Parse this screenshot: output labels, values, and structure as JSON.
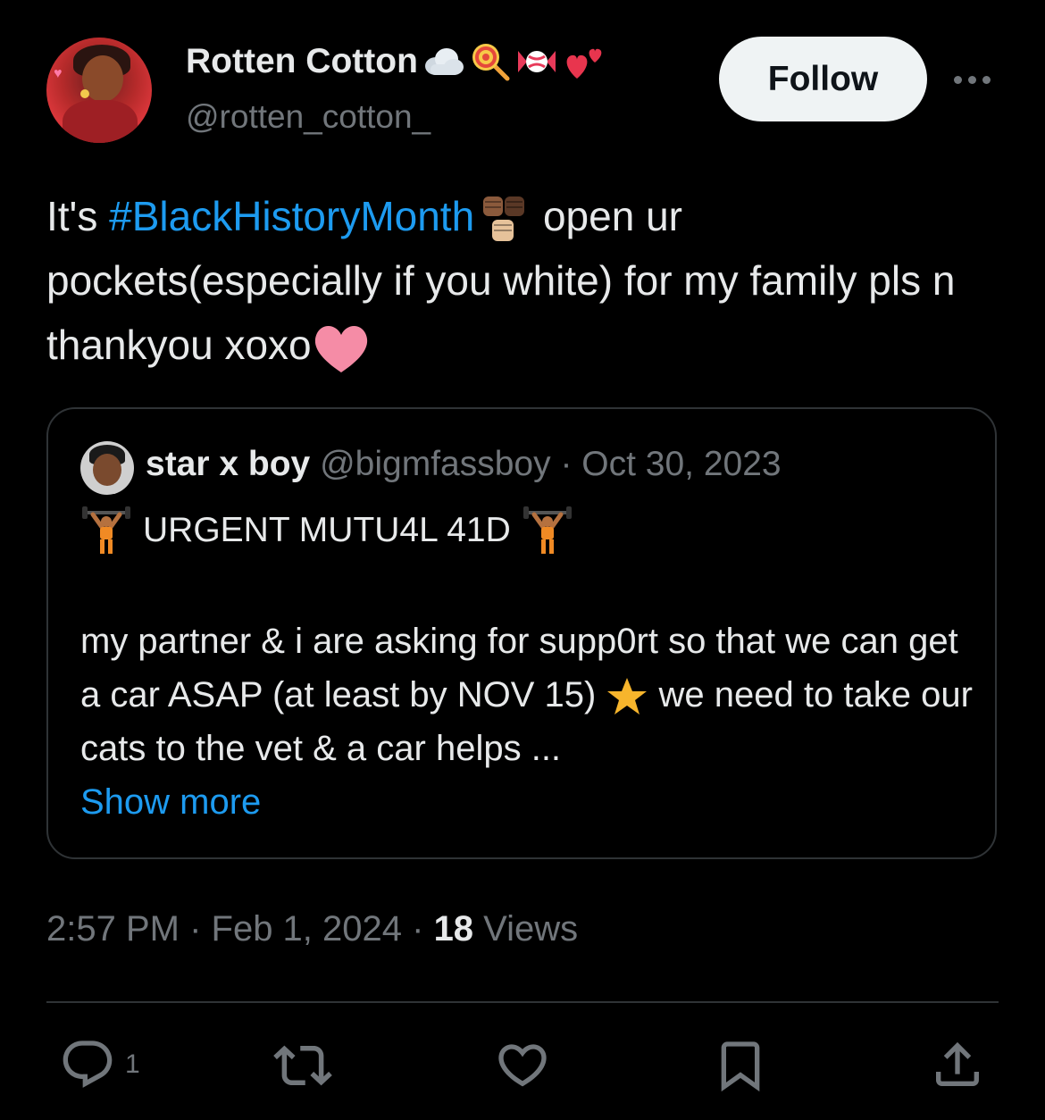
{
  "author": {
    "name": "Rotten Cotton",
    "name_emojis": [
      "cloud-icon",
      "lollipop-icon",
      "candy-icon",
      "two-hearts-icon"
    ],
    "handle": "@rotten_cotton_"
  },
  "follow_label": "Follow",
  "tweet": {
    "text_before": "It's ",
    "hashtag": "#BlackHistoryMonth",
    "text_after_emoji": " open ur pockets(especially if you white) for my family pls n thankyou xoxo"
  },
  "quote": {
    "name": "star x boy",
    "handle": "@bigmfassboy",
    "separator": " · ",
    "date": "Oct 30, 2023",
    "line1": "URGENT MUTU4L 41D",
    "body_part1": "my partner & i are asking for supp0rt so that we can get a car ASAP (at least by NOV 15) ",
    "body_part2": " we need to take our cats to the vet & a car helps ...",
    "show_more": "Show more"
  },
  "meta": {
    "time": "2:57 PM",
    "sep1": " · ",
    "date": "Feb 1, 2024",
    "sep2": " · ",
    "views_count": "18",
    "views_label": " Views"
  },
  "actions": {
    "reply_count": "1"
  },
  "colors": {
    "background": "#000000",
    "text": "#e7e9ea",
    "muted": "#71767b",
    "link": "#1d9bf0",
    "border": "#2f3336"
  }
}
